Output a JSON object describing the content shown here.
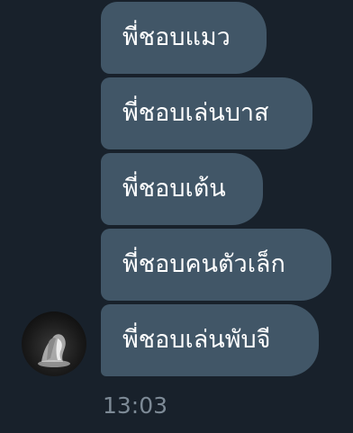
{
  "messages": [
    {
      "text": "พี่ชอบแมว"
    },
    {
      "text": "พี่ชอบเล่นบาส"
    },
    {
      "text": "พี่ชอบเต้น"
    },
    {
      "text": "พี่ชอบคนตัวเล็ก"
    },
    {
      "text": "พี่ชอบเล่นพับจี"
    }
  ],
  "timestamp": "13:03",
  "colors": {
    "background": "#18212b",
    "bubble": "#415667",
    "text": "#ffffff",
    "timestamp": "#7d8a96"
  }
}
